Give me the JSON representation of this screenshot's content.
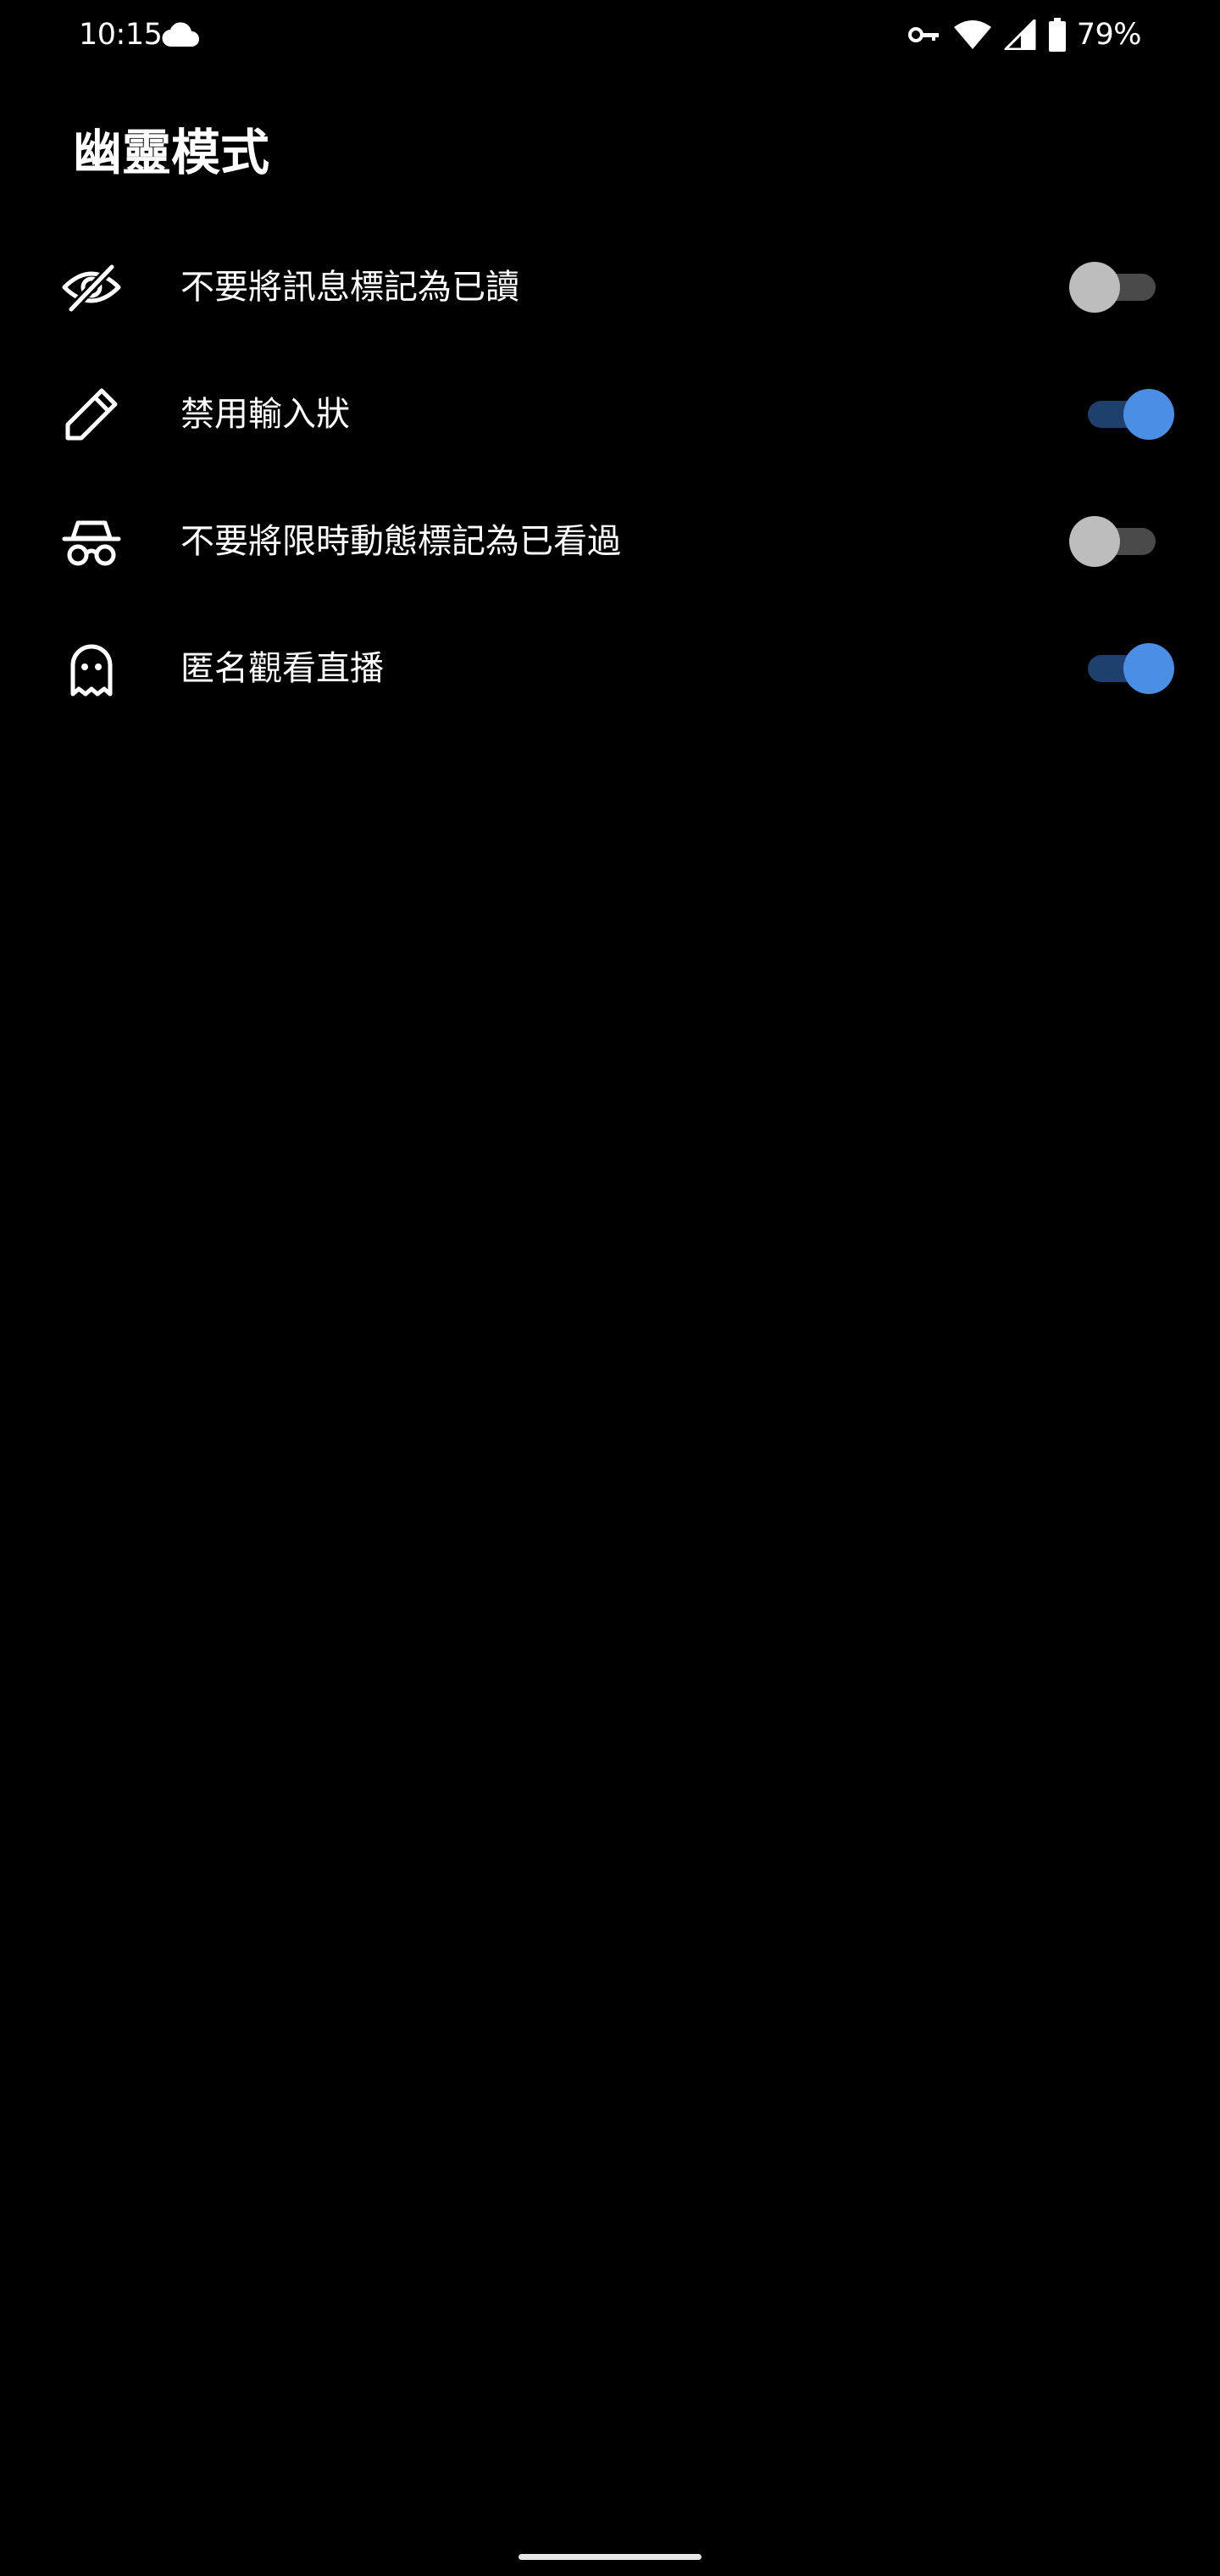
{
  "status_bar": {
    "time": "10:15",
    "battery_percent": "79%",
    "icons": [
      "cloud-icon",
      "vpn-key-icon",
      "wifi-icon",
      "cell-signal-icon",
      "battery-icon"
    ]
  },
  "title": "幽靈模式",
  "settings": [
    {
      "label": "不要將訊息標記為已讀",
      "icon": "eye-off-icon",
      "enabled": false
    },
    {
      "label": "禁用輸入狀",
      "icon": "pencil-icon",
      "enabled": true
    },
    {
      "label": "不要將限時動態標記為已看過",
      "icon": "incognito-icon",
      "enabled": false
    },
    {
      "label": "匿名觀看直播",
      "icon": "ghost-icon",
      "enabled": true
    }
  ],
  "colors": {
    "background": "#000000",
    "accent": "#4a8ee6",
    "toggle_on_track": "#1f3f6c",
    "toggle_off_thumb": "#bdbdbd",
    "toggle_off_track": "#4a4a4a"
  }
}
